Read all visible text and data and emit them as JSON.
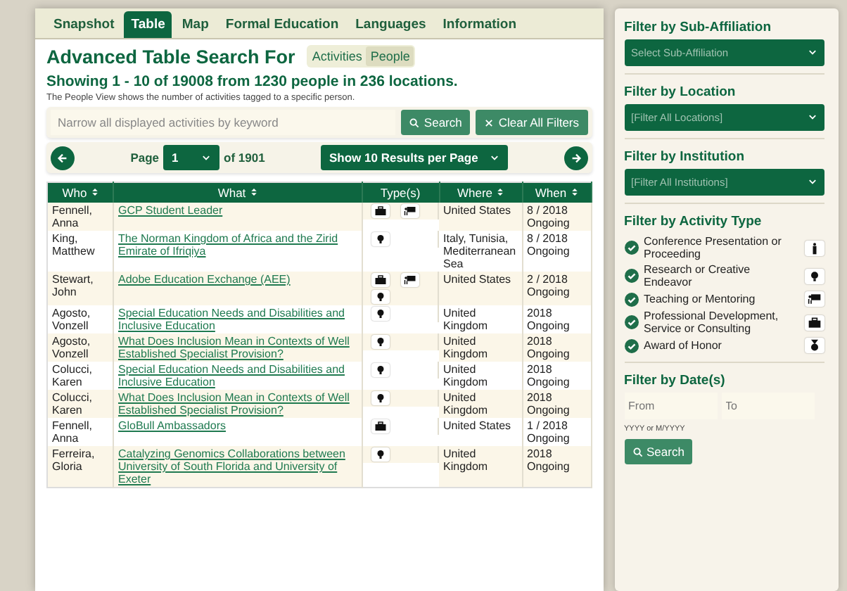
{
  "tabs": [
    {
      "label": "Snapshot",
      "selected": false
    },
    {
      "label": "Table",
      "selected": true
    },
    {
      "label": "Map",
      "selected": false
    },
    {
      "label": "Formal Education",
      "selected": false
    },
    {
      "label": "Languages",
      "selected": false
    },
    {
      "label": "Information",
      "selected": false
    }
  ],
  "heading": "Advanced Table Search For",
  "view_toggle": [
    {
      "label": "Activities",
      "selected": false
    },
    {
      "label": "People",
      "selected": true
    }
  ],
  "summary": "Showing 1 - 10 of 19008 from 1230 people in 236 locations.",
  "note": "The People View shows the number of activities tagged to a specific person.",
  "search": {
    "placeholder": "Narrow all displayed activities by keyword",
    "search_button": "Search",
    "clear_button": "Clear All Filters"
  },
  "pager": {
    "page_label": "Page",
    "page": "1",
    "of_label": "of 1901",
    "per_page": "Show 10 Results per Page"
  },
  "table": {
    "columns": [
      {
        "label": "Who",
        "sortable": true
      },
      {
        "label": "What",
        "sortable": true
      },
      {
        "label": "Type(s)",
        "sortable": false
      },
      {
        "label": "Where",
        "sortable": true
      },
      {
        "label": "When",
        "sortable": true
      }
    ],
    "rows": [
      {
        "who": "Fennell, Anna",
        "what": "GCP Student Leader",
        "types": [
          {
            "kind": "briefcase"
          },
          {
            "kind": "chalkboard"
          }
        ],
        "where": "United States",
        "when": [
          "8 / 2018",
          "Ongoing"
        ]
      },
      {
        "who": "King, Matthew",
        "what": "The Norman Kingdom of Africa and the Zirid Emirate of Ifriqiya",
        "types": [
          {
            "kind": "bulb"
          }
        ],
        "where": "Italy, Tunisia, Mediterranean Sea",
        "when": [
          "8 / 2018",
          "Ongoing"
        ]
      },
      {
        "who": "Stewart, John",
        "what": "Adobe Education Exchange (AEE)",
        "types": [
          {
            "kind": "briefcase"
          },
          {
            "kind": "chalkboard"
          },
          {
            "kind": "bulb"
          }
        ],
        "where": "United States",
        "when": [
          "2 / 2018",
          "Ongoing"
        ]
      },
      {
        "who": "Agosto, Vonzell",
        "what": "Special Education Needs and Disabilities and Inclusive Education",
        "types": [
          {
            "kind": "bulb"
          }
        ],
        "where": "United Kingdom",
        "when": [
          "2018",
          "Ongoing"
        ]
      },
      {
        "who": "Agosto, Vonzell",
        "what": "What Does Inclusion Mean in Contexts of Well Established Specialist Provision?",
        "types": [
          {
            "kind": "bulb"
          }
        ],
        "where": "United Kingdom",
        "when": [
          "2018",
          "Ongoing"
        ]
      },
      {
        "who": "Colucci, Karen",
        "what": "Special Education Needs and Disabilities and Inclusive Education",
        "types": [
          {
            "kind": "bulb"
          }
        ],
        "where": "United Kingdom",
        "when": [
          "2018",
          "Ongoing"
        ]
      },
      {
        "who": "Colucci, Karen",
        "what": "What Does Inclusion Mean in Contexts of Well Established Specialist Provision?",
        "types": [
          {
            "kind": "bulb"
          }
        ],
        "where": "United Kingdom",
        "when": [
          "2018",
          "Ongoing"
        ]
      },
      {
        "who": "Fennell, Anna",
        "what": "GloBull Ambassadors",
        "types": [
          {
            "kind": "briefcase"
          }
        ],
        "where": "United States",
        "when": [
          "1 / 2018",
          "Ongoing"
        ]
      },
      {
        "who": "Ferreira, Gloria",
        "what": "Catalyzing Genomics Collaborations between University of South Florida and University of Exeter",
        "types": [
          {
            "kind": "bulb"
          }
        ],
        "where": "United Kingdom",
        "when": [
          "2018",
          "Ongoing"
        ]
      }
    ]
  },
  "filters": {
    "sub_affiliation": {
      "title": "Filter by Sub-Affiliation",
      "placeholder": "Select Sub-Affiliation"
    },
    "location": {
      "title": "Filter by Location",
      "placeholder": "[Filter All Locations]"
    },
    "institution": {
      "title": "Filter by Institution",
      "placeholder": "[Filter All Institutions]"
    },
    "activity_title": "Filter by Activity Type",
    "activity_types": [
      {
        "label": "Conference Presentation or Proceeding",
        "checked": true,
        "kind": "podium"
      },
      {
        "label": "Research or Creative Endeavor",
        "checked": true,
        "kind": "bulb"
      },
      {
        "label": "Teaching or Mentoring",
        "checked": true,
        "kind": "chalkboard"
      },
      {
        "label": "Professional Development, Service or Consulting",
        "checked": true,
        "kind": "briefcase"
      },
      {
        "label": "Award of Honor",
        "checked": true,
        "kind": "medal"
      }
    ],
    "date_title": "Filter by Date(s)",
    "from_placeholder": "From",
    "to_placeholder": "To",
    "date_hint": "YYYY or M/YYYY",
    "search_button": "Search"
  }
}
